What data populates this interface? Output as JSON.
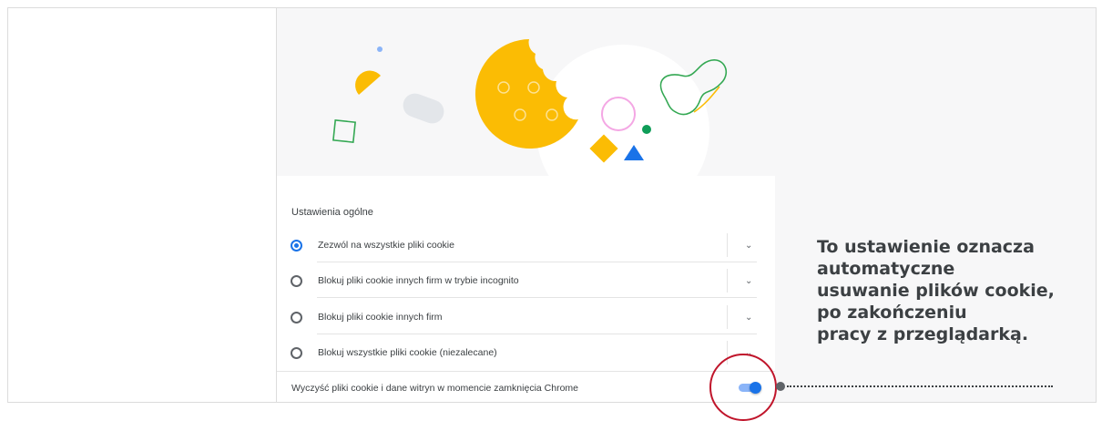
{
  "settings": {
    "section_title": "Ustawienia ogólne",
    "options": [
      {
        "label": "Zezwól na wszystkie pliki cookie",
        "selected": true
      },
      {
        "label": "Blokuj pliki cookie innych firm w trybie incognito",
        "selected": false
      },
      {
        "label": "Blokuj pliki cookie innych firm",
        "selected": false
      },
      {
        "label": "Blokuj wszystkie pliki cookie (niezalecane)",
        "selected": false
      }
    ],
    "clear_on_exit": {
      "label": "Wyczyść pliki cookie i dane witryn w momencie zamknięcia Chrome",
      "enabled": true
    }
  },
  "annotation": {
    "lines": [
      "To ustawienie oznacza",
      "automatyczne",
      "usuwanie plików cookie,",
      "po zakończeniu",
      "pracy z przeglądarką."
    ]
  },
  "colors": {
    "accent": "#1a73e8",
    "cookie": "#fbbc04",
    "highlight_circle": "#c0152b"
  }
}
